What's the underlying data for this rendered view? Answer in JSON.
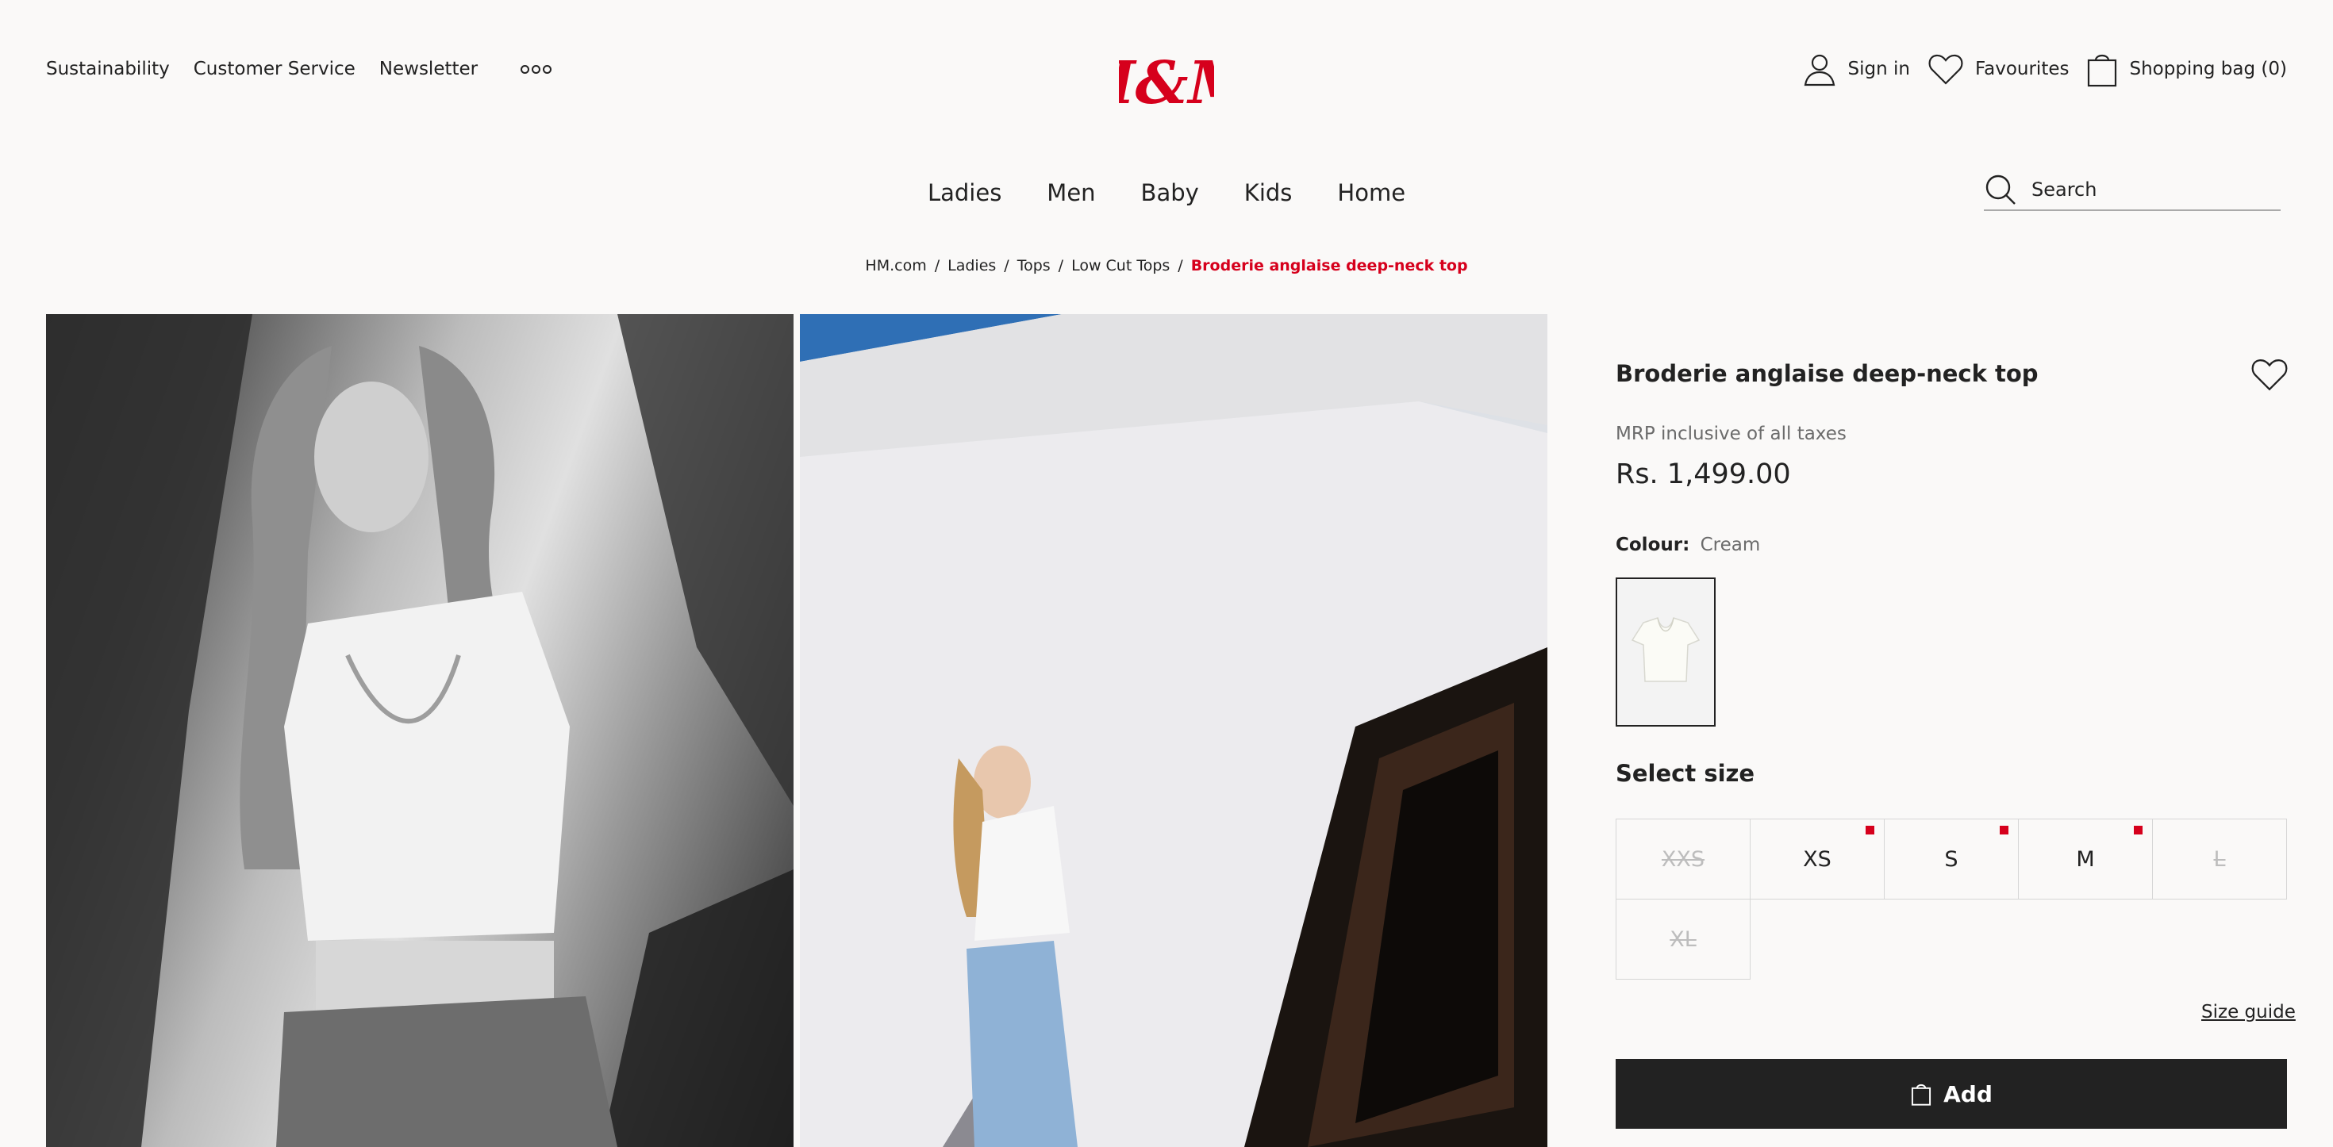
{
  "header": {
    "top_links": [
      "Sustainability",
      "Customer Service",
      "Newsletter"
    ],
    "more_icon": "more-dots-icon",
    "logo_text": "H&M",
    "sign_in": "Sign in",
    "favourites": "Favourites",
    "bag": "Shopping bag (0)",
    "brand_color": "#d6001c"
  },
  "nav": {
    "items": [
      "Ladies",
      "Men",
      "Baby",
      "Kids",
      "Home"
    ],
    "search_placeholder": "Search"
  },
  "breadcrumb": {
    "items": [
      "HM.com",
      "Ladies",
      "Tops",
      "Low Cut Tops"
    ],
    "current": "Broderie anglaise deep-neck top"
  },
  "product": {
    "title": "Broderie anglaise deep-neck top",
    "mrp_note": "MRP inclusive of all taxes",
    "price": "Rs. 1,499.00",
    "colour_label": "Colour:",
    "colour_value": "Cream",
    "select_size": "Select size",
    "sizes": [
      {
        "label": "XXS",
        "available": false,
        "low_stock": false
      },
      {
        "label": "XS",
        "available": true,
        "low_stock": true
      },
      {
        "label": "S",
        "available": true,
        "low_stock": true
      },
      {
        "label": "M",
        "available": true,
        "low_stock": true
      },
      {
        "label": "L",
        "available": false,
        "low_stock": false
      },
      {
        "label": "XL",
        "available": false,
        "low_stock": false
      }
    ],
    "size_guide": "Size guide",
    "add_label": "Add"
  }
}
